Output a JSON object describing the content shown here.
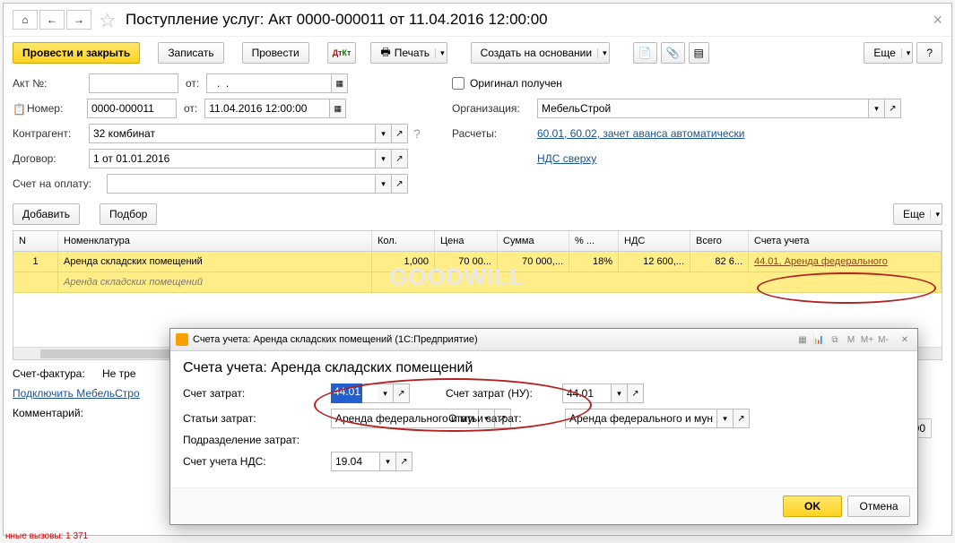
{
  "title": "Поступление услуг: Акт 0000-000011 от 11.04.2016 12:00:00",
  "toolbar": {
    "post_close": "Провести и закрыть",
    "save": "Записать",
    "post": "Провести",
    "print": "Печать",
    "create_based": "Создать на основании",
    "more": "Еще",
    "help": "?"
  },
  "form": {
    "akt_label": "Акт №:",
    "akt_value": "",
    "ot": "от:",
    "ot1_value": "  .  .",
    "nomer_label": "Номер:",
    "nomer_value": "0000-000011",
    "ot2_value": "11.04.2016 12:00:00",
    "kontragent_label": "Контрагент:",
    "kontragent_value": "32 комбинат",
    "dogovor_label": "Договор:",
    "dogovor_value": "1 от 01.01.2016",
    "schet_label": "Счет на оплату:",
    "schet_value": "",
    "original_label": "Оригинал получен",
    "org_label": "Организация:",
    "org_value": "МебельСтрой",
    "raschety_label": "Расчеты:",
    "raschety_link": "60.01, 60.02, зачет аванса автоматически",
    "nds_link": "НДС сверху"
  },
  "gridbar": {
    "add": "Добавить",
    "pick": "Подбор",
    "more": "Еще"
  },
  "grid": {
    "headers": [
      "N",
      "Номенклатура",
      "Кол.",
      "Цена",
      "Сумма",
      "% ...",
      "НДС",
      "Всего",
      "Счета учета"
    ],
    "row": {
      "n": "1",
      "nomen": "Аренда складских помещений",
      "qty": "1,000",
      "price": "70 00...",
      "sum": "70 000,...",
      "pct": "18%",
      "nds": "12 600,...",
      "total": "82 6...",
      "account": "44.01, Аренда федерального"
    },
    "row2": {
      "nomen": "Аренда складских помещений"
    }
  },
  "footer": {
    "sf_label": "Счет-фактура:",
    "sf_value": "Не тре",
    "connect_link": "Подключить МебельСтро",
    "comment_label": "Комментарий:",
    "total_value": "00,00"
  },
  "modal": {
    "wintitle": "Счета учета: Аренда складских помещений  (1С:Предприятие)",
    "head": "Счета учета: Аренда складских помещений",
    "schet_zatrat": "Счет затрат:",
    "schet_zatrat_val": "44.01",
    "stati_zatrat": "Статьи затрат:",
    "stati_zatrat_val": "Аренда федерального и мун",
    "podrazd": "Подразделение затрат:",
    "schet_nds": "Счет учета НДС:",
    "schet_nds_val": "19.04",
    "schet_zatrat_nu": "Счет затрат (НУ):",
    "schet_zatrat_nu_val": "44.01",
    "stati_zatrat2": "Статьи затрат:",
    "stati_zatrat2_val": "Аренда федерального и муни",
    "ok": "OK",
    "cancel": "Отмена"
  },
  "status": "нные вызовы: 1 371",
  "watermark": "GOODWILL"
}
